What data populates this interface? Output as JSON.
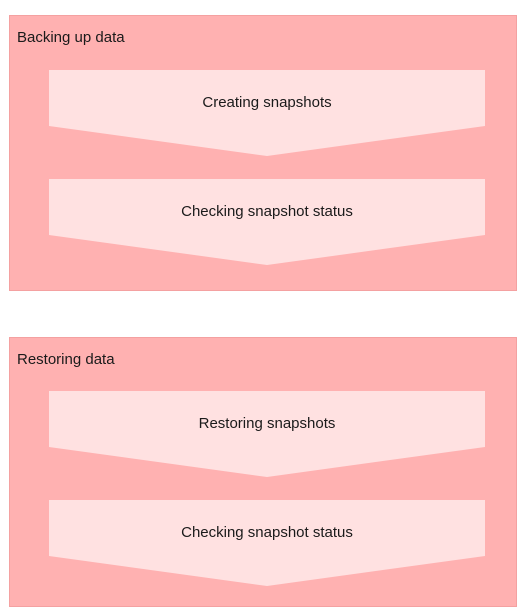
{
  "colors": {
    "section_fill": "#ffb1b1",
    "step_fill": "#ffe1e1",
    "text": "#1a1a1a"
  },
  "sections": [
    {
      "title": "Backing up data",
      "steps": [
        {
          "label": "Creating snapshots"
        },
        {
          "label": "Checking snapshot status"
        }
      ]
    },
    {
      "title": "Restoring data",
      "steps": [
        {
          "label": "Restoring snapshots"
        },
        {
          "label": "Checking snapshot status"
        }
      ]
    }
  ]
}
